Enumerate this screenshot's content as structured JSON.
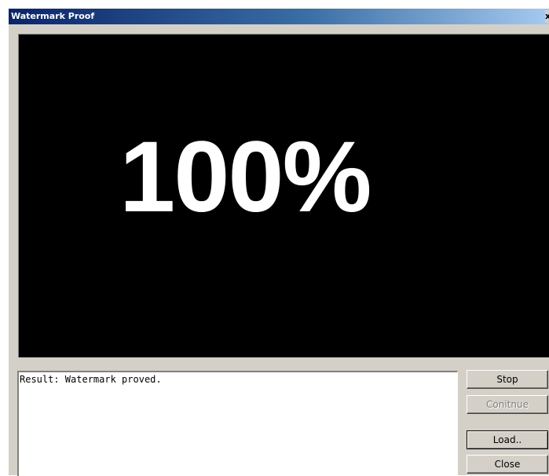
{
  "window": {
    "title": "Watermark Proof",
    "close_glyph": "x"
  },
  "preview": {
    "progress_text": "100%",
    "progress": 1.0
  },
  "result": {
    "text": "Result: Watermark proved."
  },
  "buttons": {
    "stop": "Stop",
    "continue": "Conitnue",
    "load": "Load..",
    "close": "Close"
  }
}
